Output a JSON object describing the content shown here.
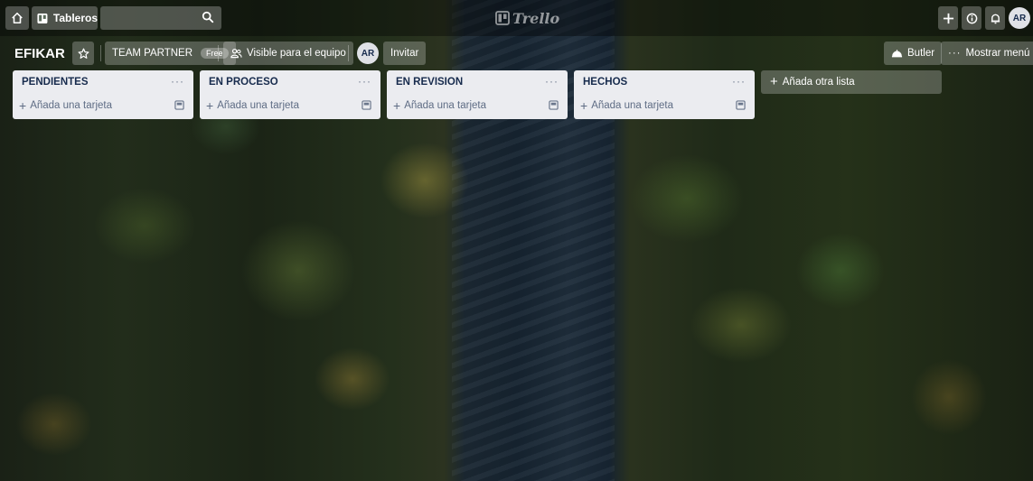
{
  "header": {
    "boards_label": "Tableros",
    "logo_text": "Trello",
    "avatar_initials": "AR"
  },
  "board": {
    "title": "EFIKAR",
    "team_label": "TEAM PARTNER",
    "team_badge": "Free",
    "visibility_label": "Visible para el equipo",
    "member_initials": "AR",
    "invite_label": "Invitar",
    "butler_label": "Butler",
    "menu_label": "Mostrar menú"
  },
  "lists": [
    {
      "title": "PENDIENTES",
      "menu": "···",
      "add_card": "Añada una tarjeta"
    },
    {
      "title": "EN PROCESO",
      "menu": "···",
      "add_card": "Añada una tarjeta"
    },
    {
      "title": "EN REVISION",
      "menu": "···",
      "add_card": "Añada una tarjeta"
    },
    {
      "title": "HECHOS",
      "menu": "···",
      "add_card": "Añada una tarjeta"
    }
  ],
  "add_list_label": "Añada otra lista",
  "colors": {
    "list_bg": "#ebecf0",
    "list_text": "#172b4d",
    "header_overlay": "rgba(0,0,0,0.35)"
  }
}
